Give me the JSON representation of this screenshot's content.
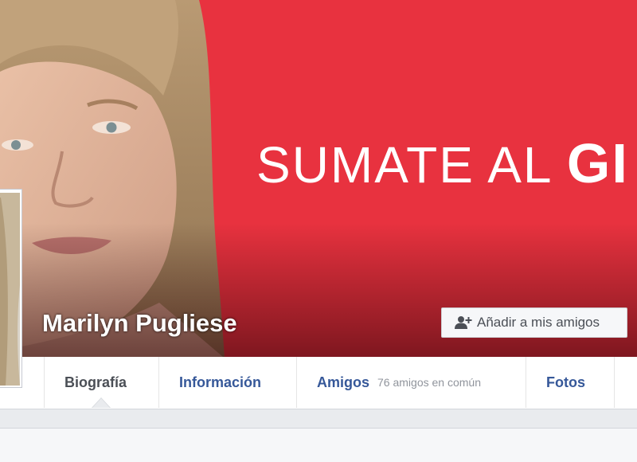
{
  "profile": {
    "name": "Marilyn Pugliese",
    "add_friend_label": "Añadir a mis amigos"
  },
  "cover": {
    "slogan_prefix": "SUMATE AL",
    "slogan_bold": "GI",
    "background_color": "#e8323f"
  },
  "tabs": [
    {
      "label": "Biografía",
      "active": true
    },
    {
      "label": "Información",
      "active": false
    },
    {
      "label": "Amigos",
      "sub": "76 amigos en común",
      "active": false
    },
    {
      "label": "Fotos",
      "active": false
    }
  ],
  "colors": {
    "link": "#365899",
    "active_tab": "#4b4f56",
    "page_background": "#e9ebee"
  }
}
